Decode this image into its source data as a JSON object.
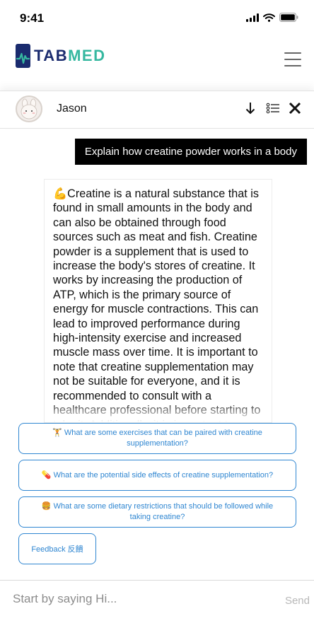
{
  "status_bar": {
    "time": "9:41"
  },
  "brand": {
    "logo_tab": "TAB",
    "logo_med": "MED",
    "colors": {
      "tab": "#1a2b6e",
      "med": "#36b8a0",
      "link": "#2f86d1"
    }
  },
  "chat": {
    "user_name": "Jason",
    "user_message": "Explain how creatine powder works in a body",
    "bot_emoji": "💪",
    "bot_message": "Creatine is a natural substance that is found in small amounts in the body and can also be obtained through food sources such as meat and fish. Creatine powder is a supplement that is used to increase the body's stores of creatine. It works by increasing the production of ATP, which is the primary source of energy for muscle contractions. This can lead to improved performance during high-intensity exercise and increased muscle mass over time. It is important to note that creatine supplementation may not be suitable for everyone, and it is recommended to consult with a healthcare professional before starting to take it. Additionally, it is important to follow the recommended dosage"
  },
  "suggestions": [
    {
      "emoji": "🏋️",
      "text": "What are some exercises that can be paired with creatine supplementation?"
    },
    {
      "emoji": "💊",
      "text": "What are the potential side effects of creatine supplementation?"
    },
    {
      "emoji": "🍔",
      "text": "What are some dietary restrictions that should be followed while taking creatine?"
    }
  ],
  "feedback_label": "Feedback 反饋",
  "composer": {
    "placeholder": "Start by saying Hi...",
    "send_label": "Send"
  },
  "icons": [
    "signal-icon",
    "wifi-icon",
    "battery-icon",
    "logo-icon",
    "hamburger-menu-icon",
    "avatar",
    "download-icon",
    "list-icon",
    "close-icon"
  ]
}
